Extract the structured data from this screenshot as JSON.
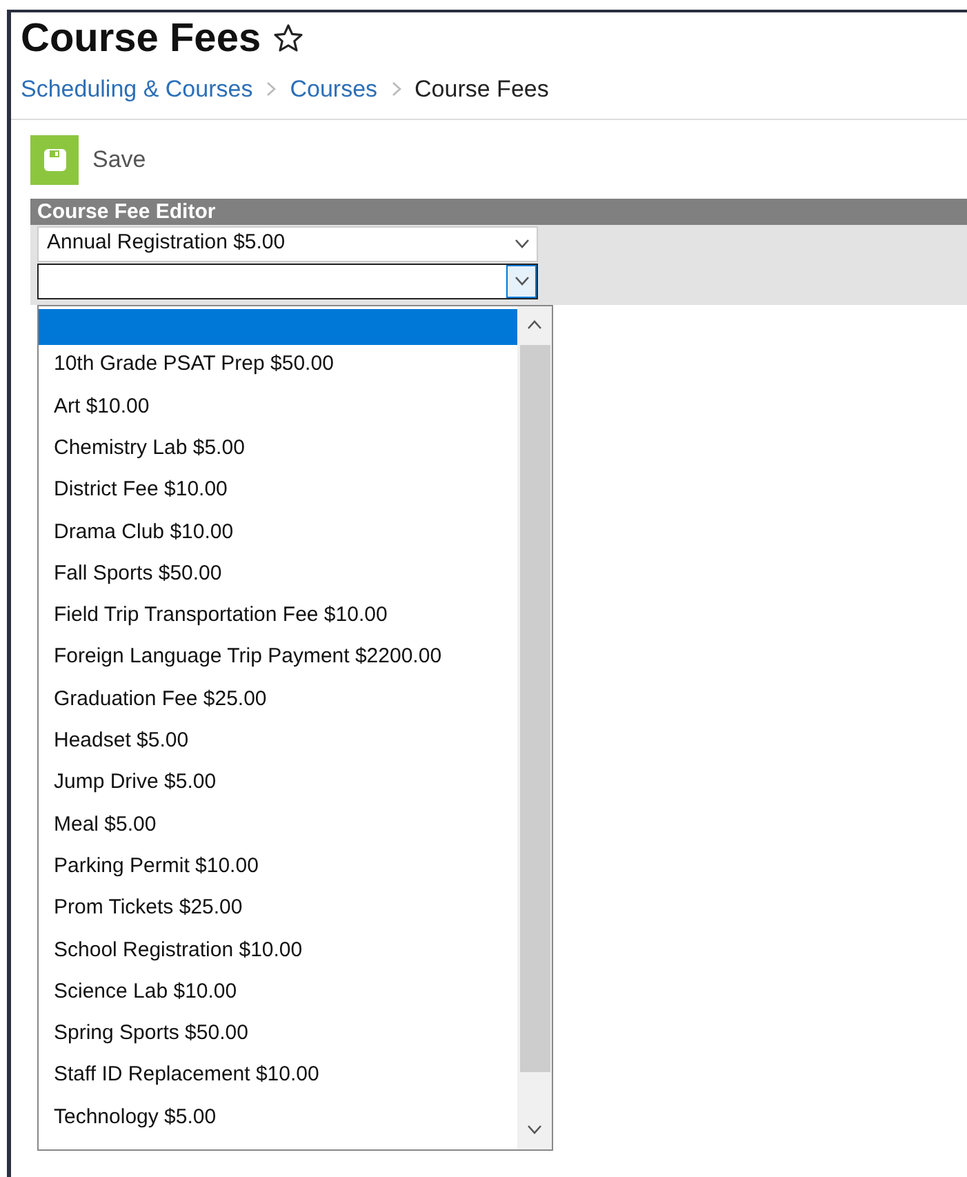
{
  "page": {
    "title": "Course Fees",
    "favorite": false
  },
  "breadcrumb": [
    {
      "label": "Scheduling & Courses",
      "kind": "link"
    },
    {
      "label": "Courses",
      "kind": "link"
    },
    {
      "label": "Course Fees",
      "kind": "current"
    }
  ],
  "toolbar": {
    "save_label": "Save"
  },
  "editor": {
    "title": "Course Fee Editor",
    "selects": [
      {
        "value": "Annual Registration $5.00",
        "focused": false
      },
      {
        "focused": true
      }
    ],
    "dropdown": [
      {
        "selected": true
      },
      {
        "label": "10th Grade PSAT Prep $50.00",
        "selected": false
      },
      {
        "label": "Art $10.00",
        "selected": false
      },
      {
        "label": "Chemistry Lab $5.00",
        "selected": false
      },
      {
        "label": "District Fee $10.00",
        "selected": false
      },
      {
        "label": "Drama Club $10.00",
        "selected": false
      },
      {
        "label": "Fall Sports $50.00",
        "selected": false
      },
      {
        "label": "Field Trip Transportation Fee $10.00",
        "selected": false
      },
      {
        "label": "Foreign Language Trip Payment $2200.00",
        "selected": false
      },
      {
        "label": "Graduation Fee $25.00",
        "selected": false
      },
      {
        "label": "Headset $5.00",
        "selected": false
      },
      {
        "label": "Jump Drive $5.00",
        "selected": false
      },
      {
        "label": "Meal $5.00",
        "selected": false
      },
      {
        "label": "Parking Permit $10.00",
        "selected": false
      },
      {
        "label": "Prom Tickets $25.00",
        "selected": false
      },
      {
        "label": "School Registration $10.00",
        "selected": false
      },
      {
        "label": "Science Lab $10.00",
        "selected": false
      },
      {
        "label": "Spring Sports $50.00",
        "selected": false
      },
      {
        "label": "Staff ID Replacement $10.00",
        "selected": false
      },
      {
        "label": "Technology $5.00",
        "selected": false
      }
    ]
  }
}
